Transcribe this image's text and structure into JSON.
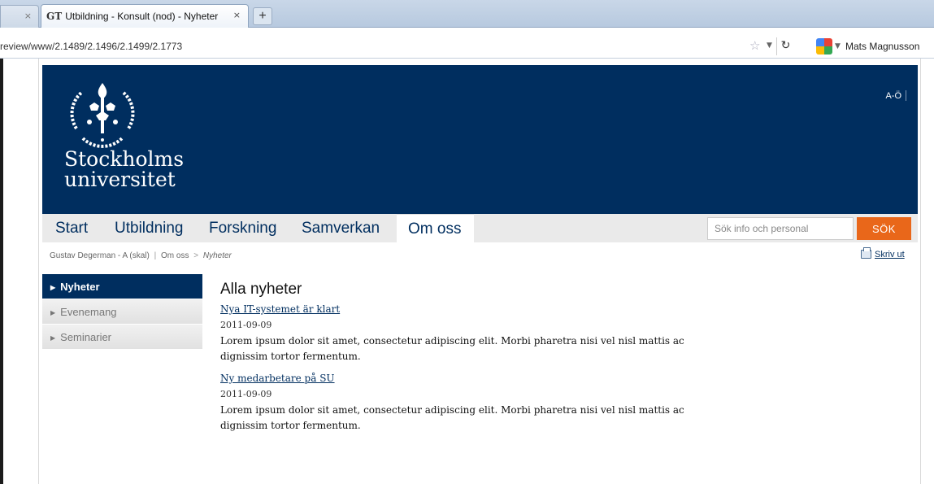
{
  "browser": {
    "tab_active_favicon": "GT",
    "tab_active_title": "Utbildning - Konsult (nod) - Nyheter",
    "close_glyph": "×",
    "new_tab_glyph": "+",
    "url": "review/www/2.1489/2.1496/2.1499/2.1773",
    "user": "Mats Magnusson",
    "icons": [
      "close-icon",
      "star-icon",
      "dropdown-icon",
      "reload-icon",
      "google-icon"
    ]
  },
  "site": {
    "logo_line1": "Stockholms",
    "logo_line2": "universitet",
    "az_link": "A-Ö",
    "brand_color": "#002e5f",
    "accent_color": "#e9671a"
  },
  "nav": {
    "items": [
      "Start",
      "Utbildning",
      "Forskning",
      "Samverkan",
      "Om oss"
    ],
    "active": "Om oss",
    "search_placeholder": "Sök info och personal",
    "search_button": "SÖK"
  },
  "breadcrumb": {
    "root": "Gustav Degerman - A (skal)",
    "separator": "|",
    "parent": "Om oss",
    "arrow": ">",
    "current": "Nyheter",
    "print_label": "Skriv ut"
  },
  "sidebar": {
    "items": [
      {
        "label": "Nyheter",
        "active": true
      },
      {
        "label": "Evenemang",
        "active": false
      },
      {
        "label": "Seminarier",
        "active": false
      }
    ]
  },
  "main": {
    "heading": "Alla nyheter",
    "news": [
      {
        "title": "Nya IT-systemet är klart",
        "date": "2011-09-09",
        "text": "Lorem ipsum dolor sit amet, consectetur adipiscing elit. Morbi pharetra nisi vel nisl mattis ac dignissim tortor fermentum."
      },
      {
        "title": "Ny medarbetare på SU",
        "date": "2011-09-09",
        "text": "Lorem ipsum dolor sit amet, consectetur adipiscing elit. Morbi pharetra nisi vel nisl mattis ac dignissim tortor fermentum."
      }
    ]
  }
}
